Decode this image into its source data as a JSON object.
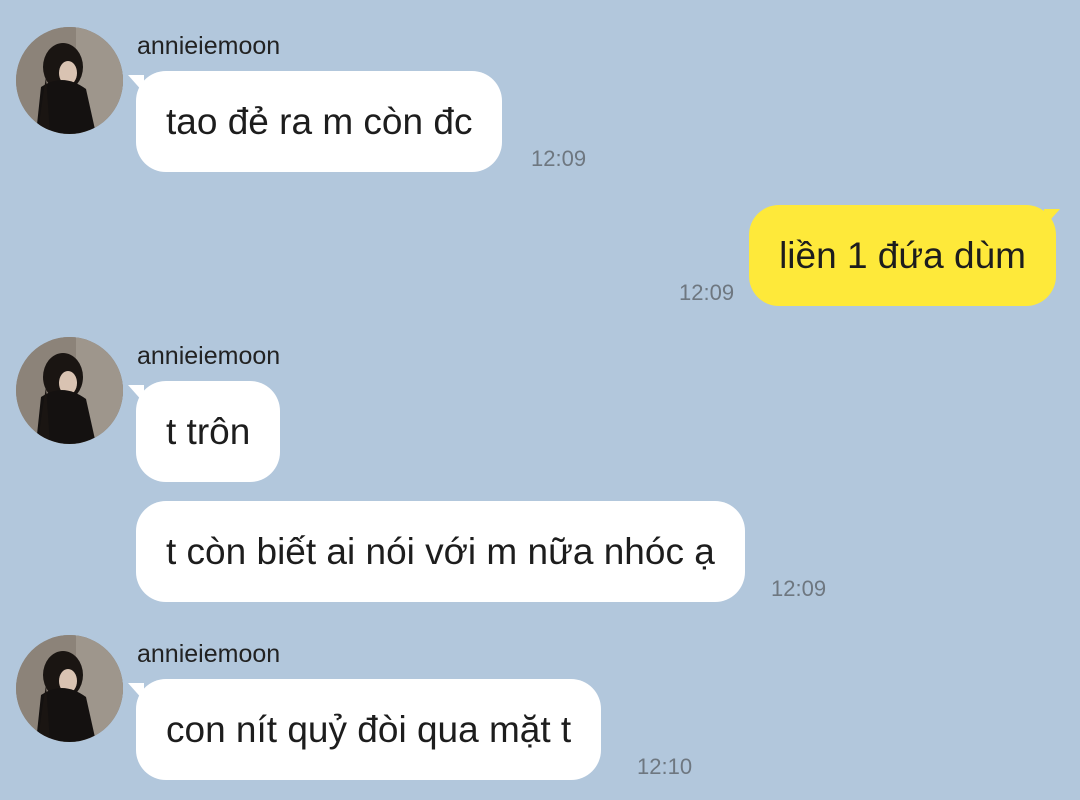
{
  "chat": {
    "background_color": "#b2c7dc",
    "incoming_bubble_color": "#ffffff",
    "outgoing_bubble_color": "#fee93a",
    "avatar_icon": "profile-photo-avatar",
    "messages": [
      {
        "sender": "annieiemoon",
        "direction": "incoming",
        "text": "tao đẻ ra m còn đc",
        "time": "12:09"
      },
      {
        "direction": "outgoing",
        "text": "liền 1 đứa dùm",
        "time": "12:09"
      },
      {
        "sender": "annieiemoon",
        "direction": "incoming",
        "text": "t trôn"
      },
      {
        "direction": "incoming",
        "text": "t còn biết ai nói với m nữa nhóc ạ",
        "time": "12:09"
      },
      {
        "sender": "annieiemoon",
        "direction": "incoming",
        "text": "con nít quỷ đòi qua mặt t",
        "time": "12:10"
      }
    ]
  }
}
